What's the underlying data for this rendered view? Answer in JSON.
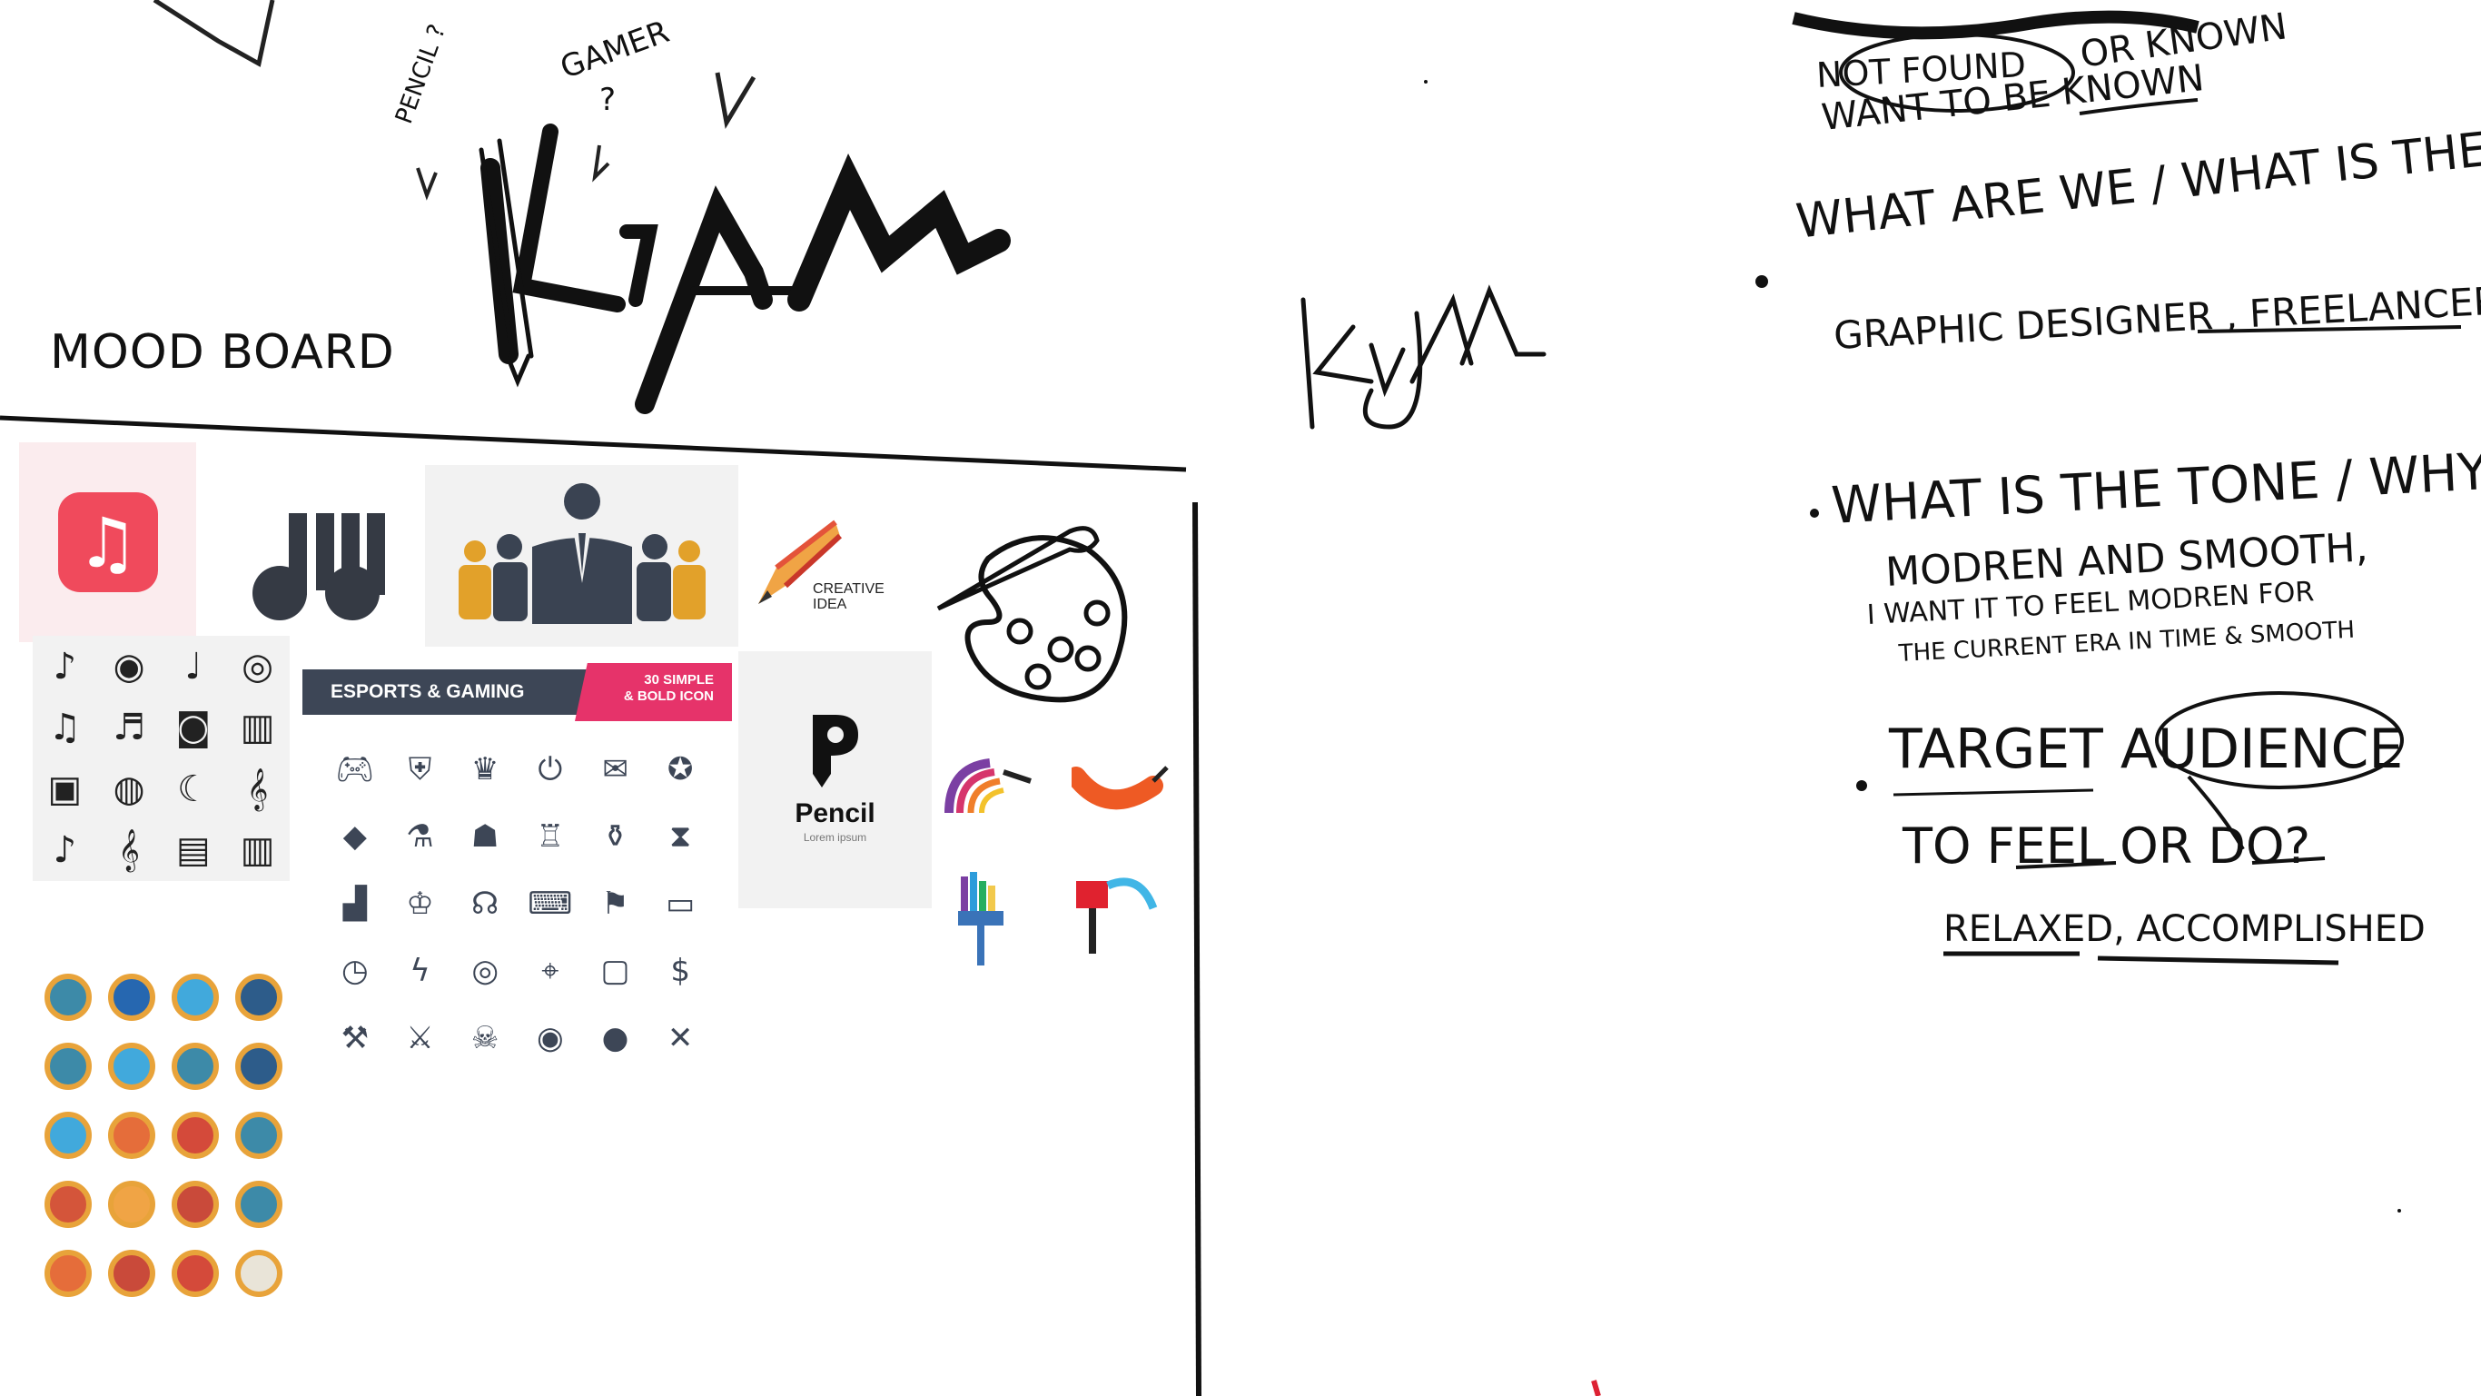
{
  "notes": {
    "mood_board": "MOOD BOARD",
    "logo_sketch_main": "KIAAM",
    "logo_sketch_alt": "KIAAM",
    "pencil_note": "PENCIL ?",
    "question_mark": "?",
    "gamer_note": "GAMER",
    "not_found": "NOT FOUND",
    "or_known": "OR KNOWN",
    "want_to_be_known": "WANT TO BE KNOWN",
    "q1": "WHAT ARE WE / WHAT IS THE SITUATION",
    "a1": "GRAPHIC DESIGNER , FREELANCER/COMPANY",
    "q2": "WHAT IS THE TONE / WHY",
    "a2_line1": "MODREN AND SMOOTH,",
    "a2_line2": "I WANT IT TO FEEL MODREN FOR",
    "a2_line3": "THE CURRENT ERA IN TIME & SMOOTH",
    "q3": "TARGET AUDIENCE",
    "a3_line1": "TO FEEL OR DO?",
    "a3_line2": "RELAXED, ACCOMPLISHED"
  },
  "moodboard": {
    "esports_title": "ESPORTS & GAMING",
    "esports_badge_line1": "30 SIMPLE",
    "esports_badge_line2": "& BOLD ICON",
    "creative_line1": "CREATIVE",
    "creative_line2": "IDEA",
    "pencil_brand": "Pencil",
    "pencil_tagline": "Lorem ipsum"
  },
  "colors": {
    "ink": "#111111",
    "apple_music": "#f04a5c",
    "esports_dark": "#3d4656",
    "esports_pink": "#e6336a",
    "gold": "#e8a33a",
    "slate": "#3a4352"
  }
}
